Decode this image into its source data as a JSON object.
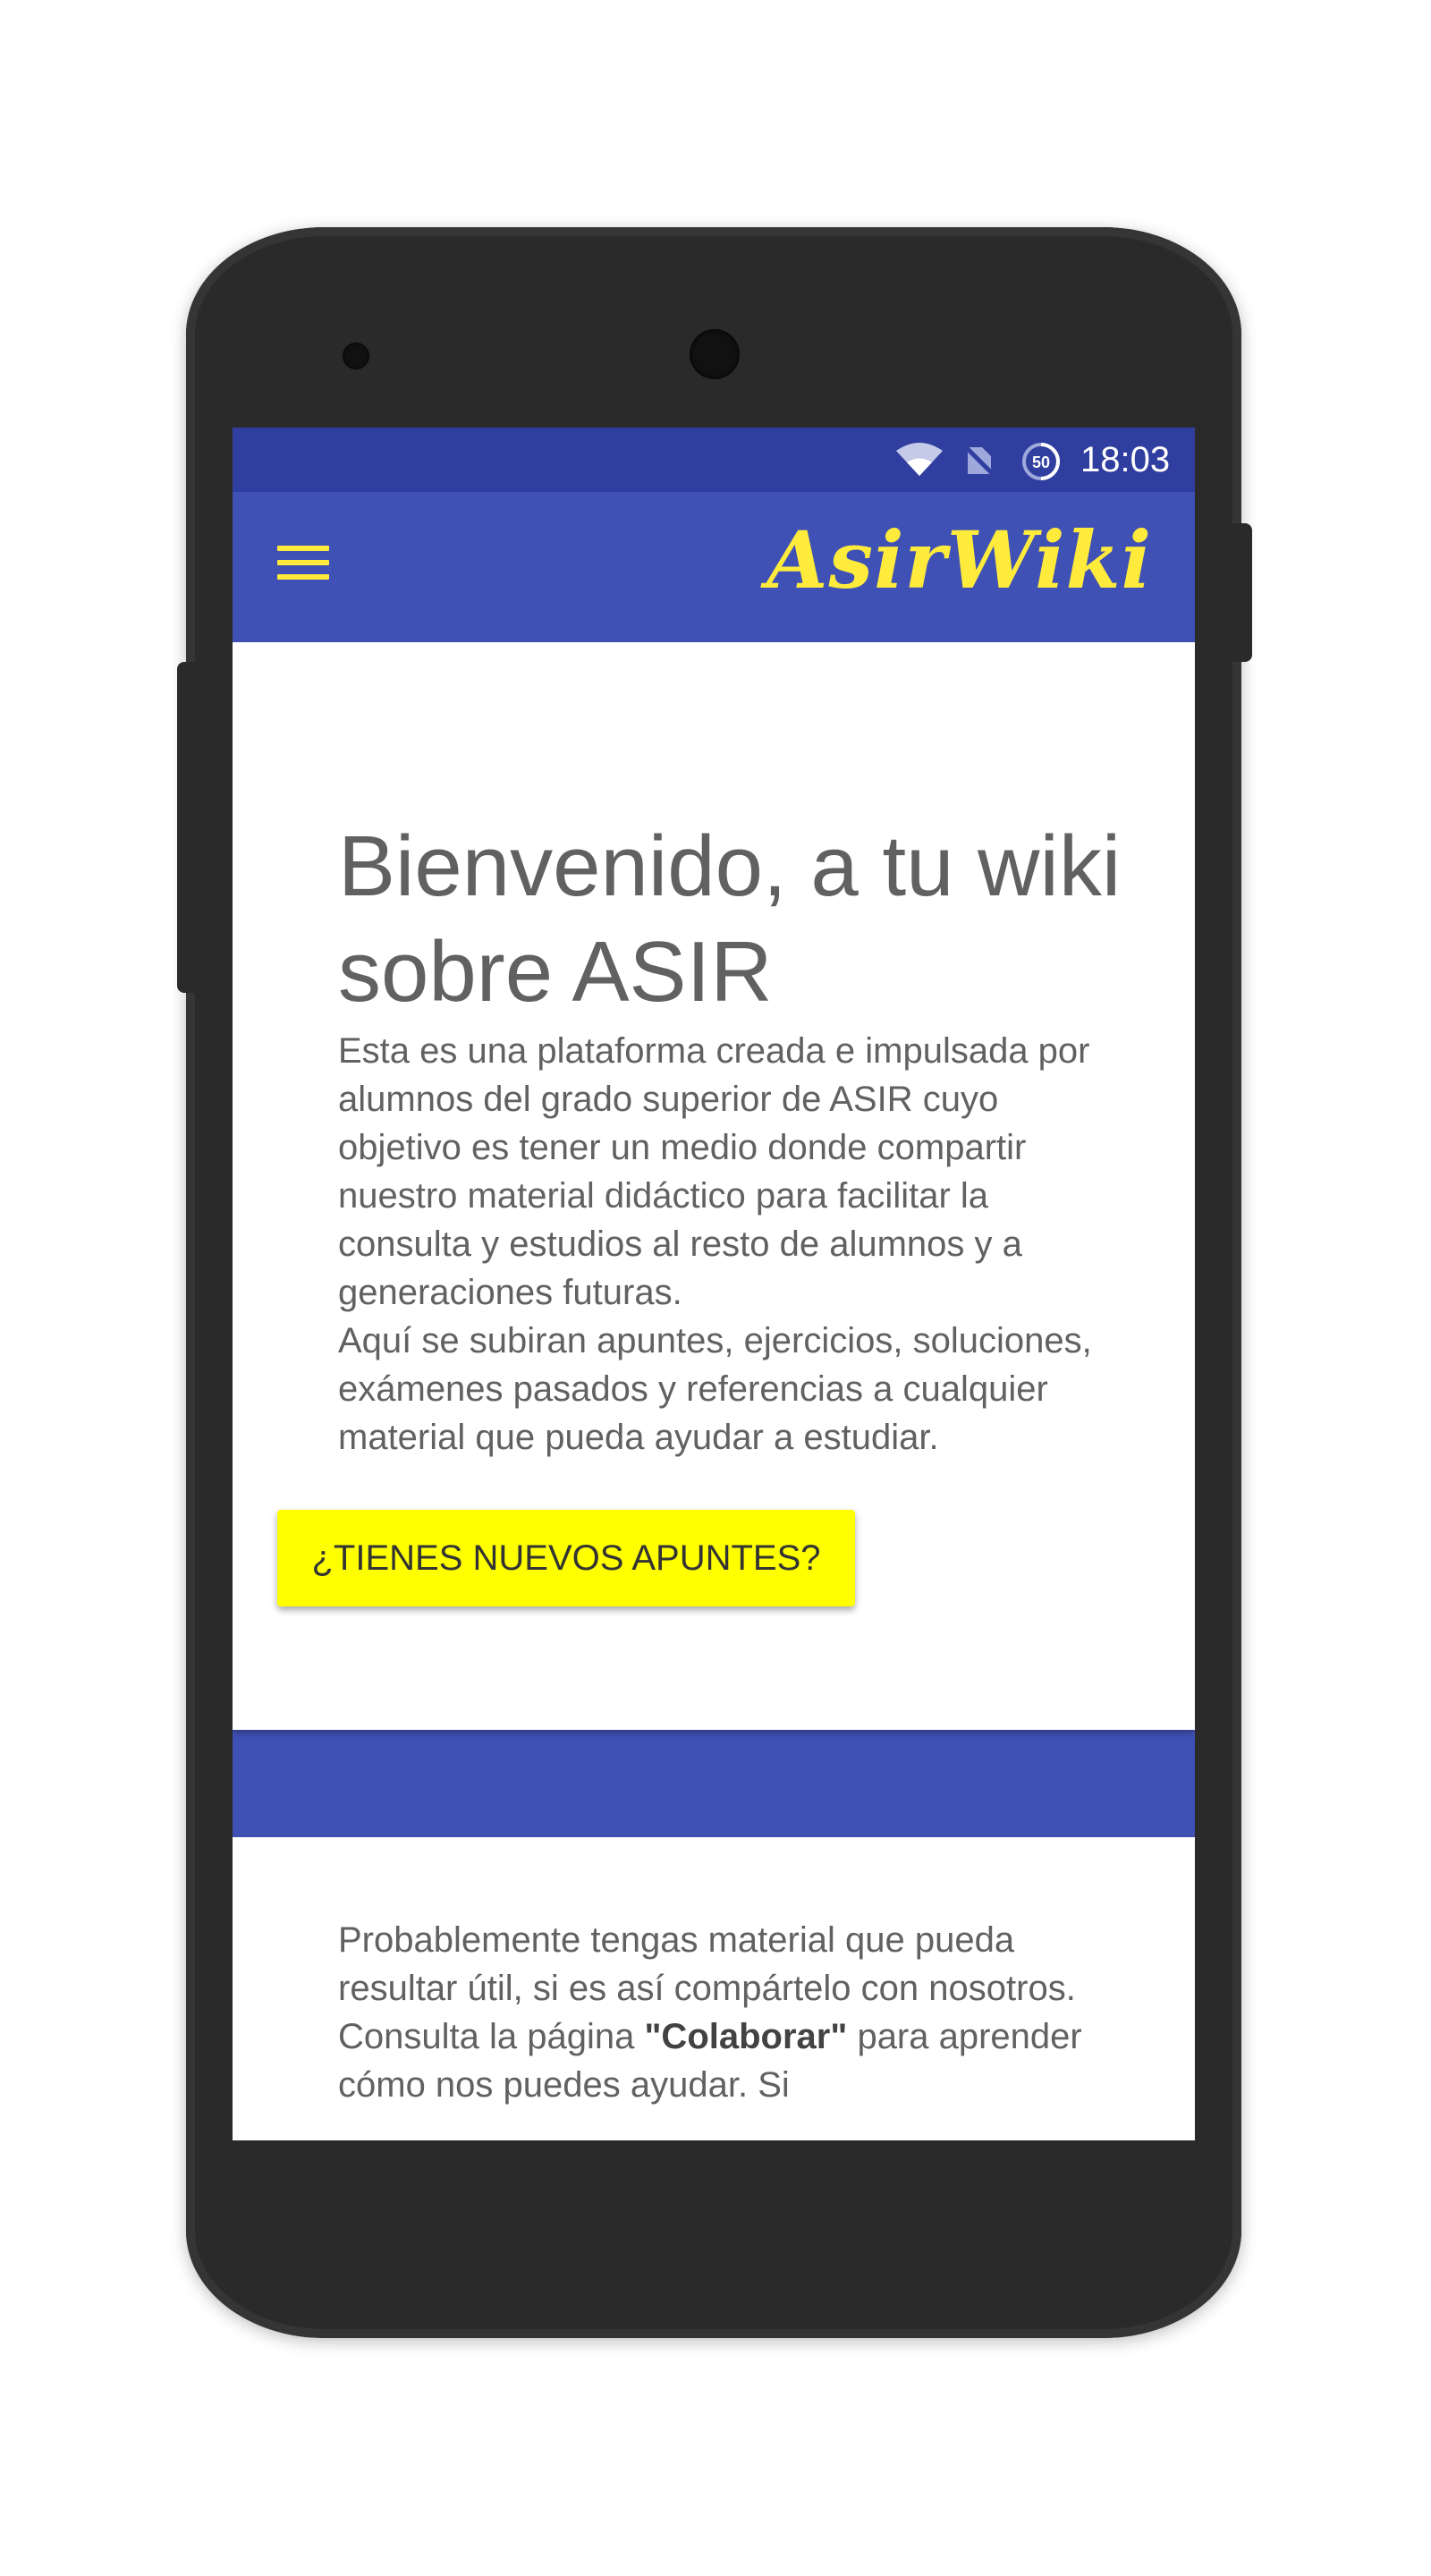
{
  "status_bar": {
    "time": "18:03",
    "battery_level": "50",
    "icons": [
      "wifi-icon",
      "no-sim-icon",
      "battery-icon"
    ]
  },
  "app_bar": {
    "title": "AsirWiki",
    "menu_icon": "hamburger-menu-icon"
  },
  "welcome": {
    "title": "Bienvenido, a tu wiki sobre ASIR",
    "paragraph_1": "Esta es una plataforma creada e impulsada por alumnos del grado superior de ASIR cuyo objetivo es tener un medio donde compartir nuestro material didáctico para facilitar la consulta y estudios al resto de alumnos y a generaciones futuras.",
    "paragraph_2": "Aquí se subiran apuntes, ejercicios, soluciones, exámenes pasados y referencias a cualquier material que pueda ayudar a estudiar."
  },
  "collaborate": {
    "text_before": "Probablemente tengas material que pueda resultar útil, si es así compártelo con nosotros. Consulta la página ",
    "link_text": "\"Colaborar\"",
    "text_after": " para aprender cómo nos puedes ayudar. Si"
  },
  "fab": {
    "label": "¿TIENES NUEVOS APUNTES?"
  },
  "colors": {
    "status_bar": "#303f9f",
    "primary": "#3f51b5",
    "accent_logo": "#ffeb3b",
    "cta_background": "#ffff00",
    "phone_frame": "#2a2a2a",
    "body_text": "#616161"
  }
}
